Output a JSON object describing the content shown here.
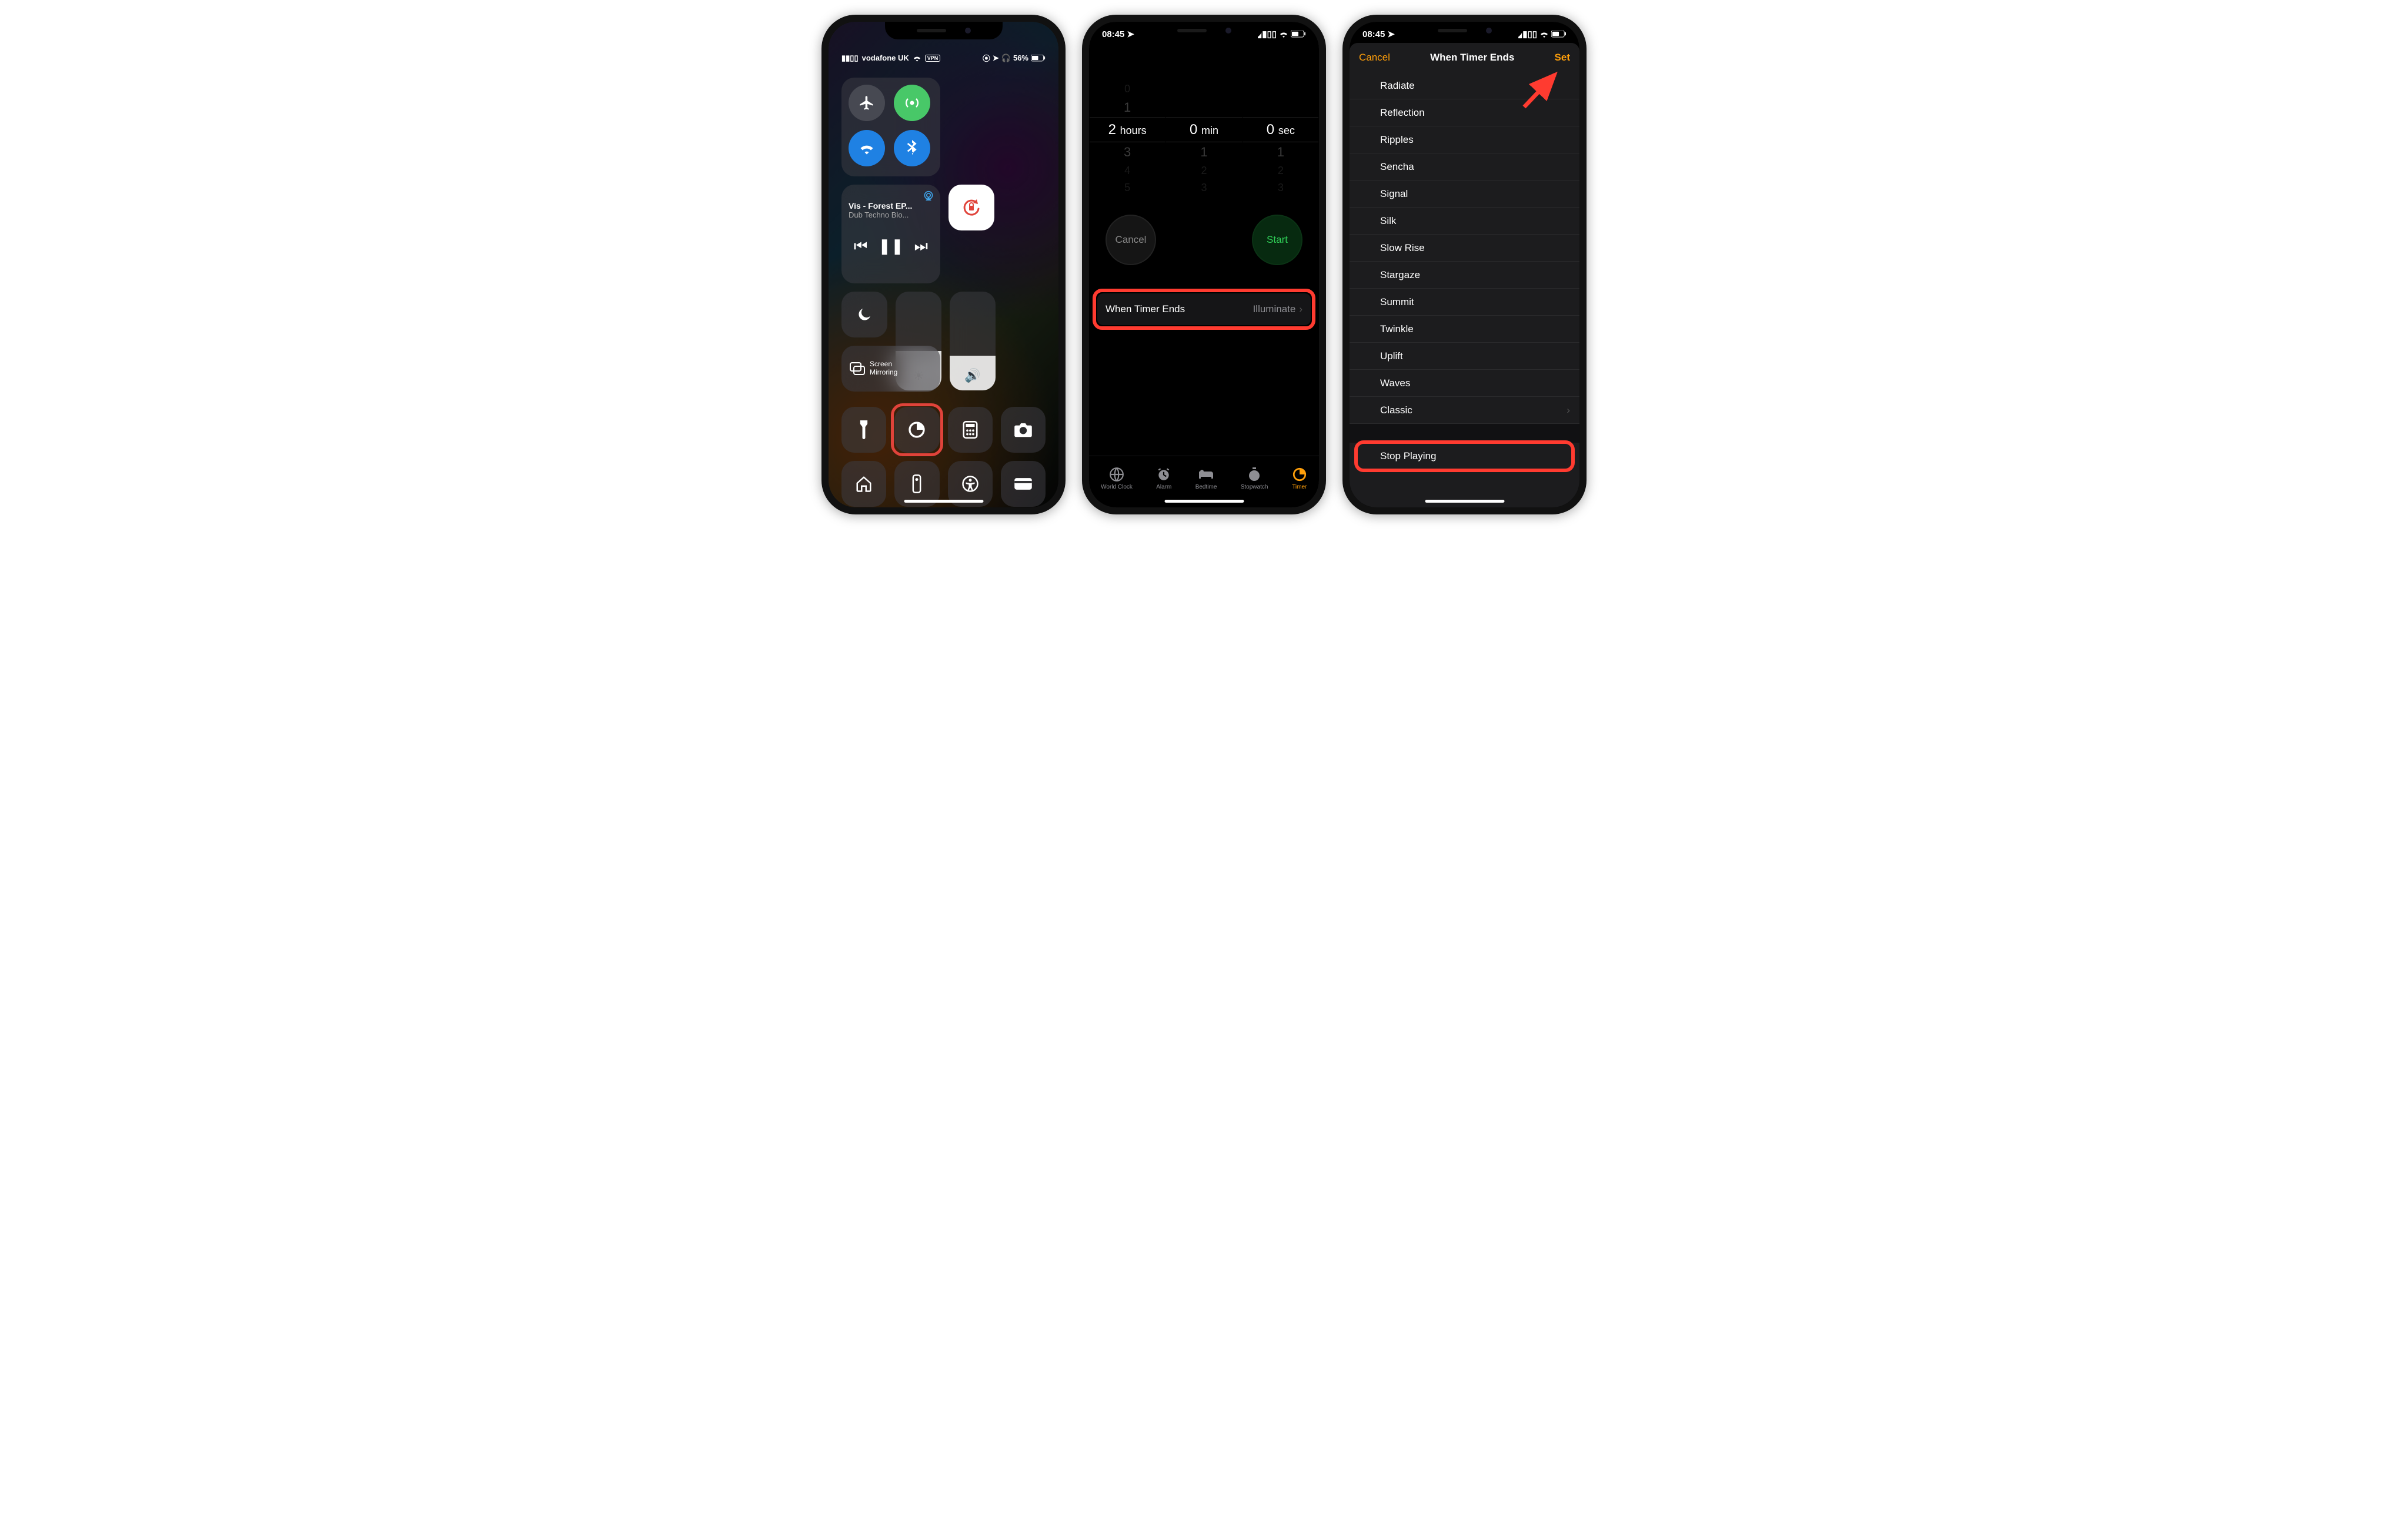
{
  "phone1": {
    "status": {
      "carrier": "vodafone UK",
      "vpn": "VPN",
      "battery": "56%"
    },
    "media": {
      "title": "Vis - Forest EP...",
      "subtitle": "Dub Techno Blo..."
    },
    "mirror_label": "Screen\nMirroring",
    "brightness_pct": 40,
    "volume_pct": 35
  },
  "phone2": {
    "status_time": "08:45",
    "picker": {
      "hours": {
        "above": [
          "0",
          "1"
        ],
        "sel": "2",
        "unit": "hours",
        "below": [
          "3",
          "4",
          "5"
        ]
      },
      "mins": {
        "above": [
          "",
          ""
        ],
        "sel": "0",
        "unit": "min",
        "below": [
          "1",
          "2",
          "3"
        ]
      },
      "secs": {
        "above": [
          "",
          ""
        ],
        "sel": "0",
        "unit": "sec",
        "below": [
          "1",
          "2",
          "3"
        ]
      }
    },
    "cancel_label": "Cancel",
    "start_label": "Start",
    "when_timer_ends": {
      "label": "When Timer Ends",
      "value": "Illuminate"
    },
    "tabs": [
      {
        "label": "World Clock"
      },
      {
        "label": "Alarm"
      },
      {
        "label": "Bedtime"
      },
      {
        "label": "Stopwatch"
      },
      {
        "label": "Timer"
      }
    ],
    "active_tab": 4
  },
  "phone3": {
    "status_time": "08:45",
    "nav": {
      "cancel": "Cancel",
      "title": "When Timer Ends",
      "set": "Set"
    },
    "tones": [
      "Radiate",
      "Reflection",
      "Ripples",
      "Sencha",
      "Signal",
      "Silk",
      "Slow Rise",
      "Stargaze",
      "Summit",
      "Twinkle",
      "Uplift",
      "Waves"
    ],
    "classic_label": "Classic",
    "stop_label": "Stop Playing"
  }
}
